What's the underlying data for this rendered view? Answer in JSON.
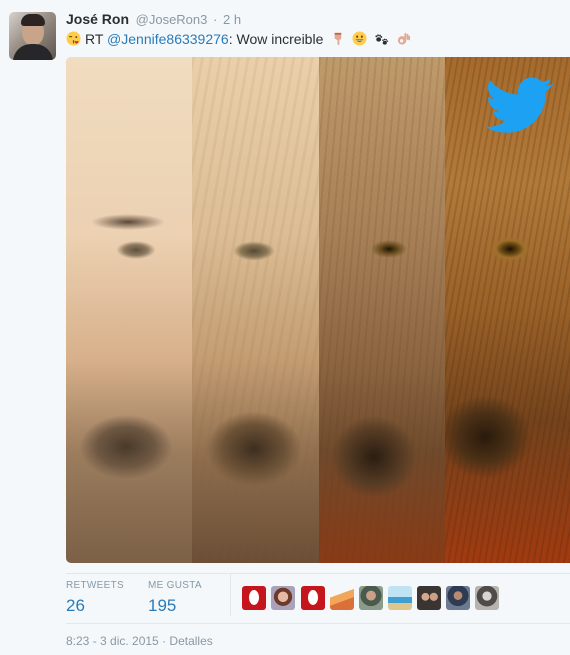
{
  "tweet": {
    "author": {
      "name": "José Ron",
      "handle": "@JoseRon3",
      "time": "2 h"
    },
    "body": {
      "prefix": "RT",
      "mention": "@Jennife86339276",
      "separator": ":",
      "text": "Wow increible"
    },
    "media": {
      "overlay": "twitter-bird-logo"
    },
    "stats": {
      "retweets": {
        "label": "RETWEETS",
        "value": "26"
      },
      "likes": {
        "label": "ME GUSTA",
        "value": "195"
      }
    },
    "likers_count_shown": 9,
    "timestamp": "8:23 - 3 dic. 2015",
    "details_link": "Detalles"
  },
  "colors": {
    "link": "#2b7bb9",
    "muted": "#8899a6",
    "text": "#292f33",
    "twitter_blue": "#1da1f2",
    "background": "#f5f8fa"
  }
}
